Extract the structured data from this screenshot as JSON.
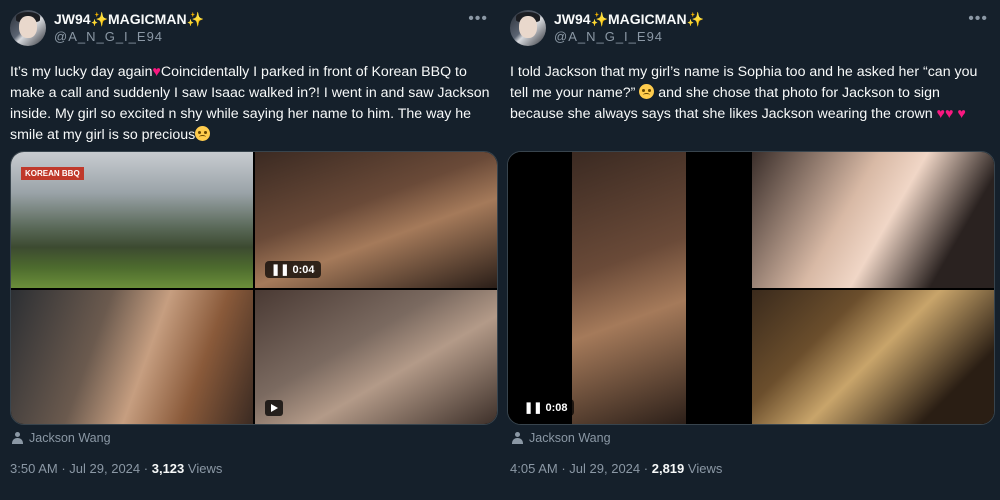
{
  "tweets": [
    {
      "display_name": "JW94✨MAGICMAN✨",
      "handle": "@A_N_G_I_E94",
      "text_parts": [
        "It’s my lucky day again",
        "Coincidentally I  parked in front of Korean BBQ to make a call and suddenly I saw Isaac walked in?! I went in and saw Jackson inside. My girl so excited n shy while saying her name to him. The way he smile at my girl is so precious"
      ],
      "media": [
        {
          "kind": "photo",
          "sign": "KOREAN BBQ"
        },
        {
          "kind": "video",
          "duration": "0:04"
        },
        {
          "kind": "photo"
        },
        {
          "kind": "video"
        }
      ],
      "tagged": "Jackson Wang",
      "time": "3:50 AM",
      "date": "Jul 29, 2024",
      "views_count": "3,123",
      "views_label": "Views"
    },
    {
      "display_name": "JW94✨MAGICMAN✨",
      "handle": "@A_N_G_I_E94",
      "text_parts": [
        "I told Jackson that my girl’s name is Sophia too and he asked her “can you tell me your name?”",
        "and she chose that photo for Jackson to sign because she always says that she likes Jackson wearing the crown"
      ],
      "media": [
        {
          "kind": "video",
          "duration": "0:08"
        },
        {
          "kind": "photo"
        },
        {
          "kind": "photo"
        }
      ],
      "tagged": "Jackson Wang",
      "time": "4:05 AM",
      "date": "Jul 29, 2024",
      "views_count": "2,819",
      "views_label": "Views"
    }
  ],
  "separator": "·",
  "more_icon": "more-icon",
  "colors": {
    "background": "#15202b",
    "text": "#f7f9f9",
    "secondary": "#8b98a5",
    "heart": "#f91880"
  }
}
